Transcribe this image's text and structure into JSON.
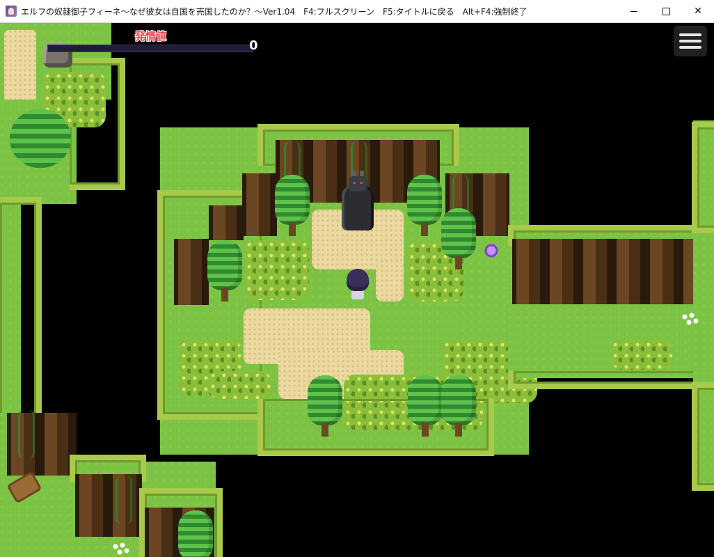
{
  "window": {
    "title": "エルフの奴隷御子フィーネ～なぜ彼女は自国を売国したのか？～Ver1.04　F4:フルスクリーン　F5:タイトルに戻る　Alt+F4:強制終了",
    "minimize_glyph": "",
    "maximize_glyph": "",
    "close_glyph": "✕"
  },
  "hud": {
    "gauge_label": "発情値",
    "gauge_value": "0",
    "gauge_fraction": 0,
    "gauge_color": "#ff3d6a",
    "menu_icon": "hamburger-menu-icon"
  },
  "scene": {
    "characters": [
      "player-character",
      "dark-armored-beast"
    ],
    "objects": [
      "forest-trees",
      "vines",
      "bushes",
      "sand-path",
      "log",
      "rock",
      "white-flowers",
      "purple-flower"
    ]
  }
}
